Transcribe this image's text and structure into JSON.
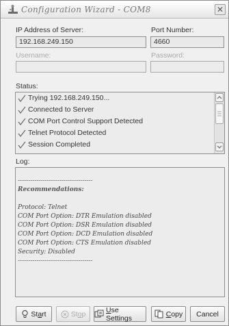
{
  "window": {
    "title": "Configuration Wizard - COM8"
  },
  "server": {
    "ip_label": "IP Address of Server:",
    "ip_value": "192.168.249.150",
    "port_label": "Port Number:",
    "port_value": "4660"
  },
  "auth": {
    "username_label": "Username:",
    "username_value": "",
    "password_label": "Password:",
    "password_value": ""
  },
  "status": {
    "label": "Status:",
    "lines": [
      "Trying 192.168.249.150...",
      "Connected to Server",
      "COM Port Control Support Detected",
      "Telnet Protocol Detected",
      "Session Completed"
    ]
  },
  "log": {
    "label": "Log:",
    "lines": [
      "------------------------------------",
      "Recommendations:",
      "",
      "Protocol: Telnet",
      "COM Port Option: DTR Emulation disabled",
      "COM Port Option: DSR Emulation disabled",
      "COM Port Option: DCD Emulation disabled",
      "COM Port Option: CTS Emulation disabled",
      "Security: Disabled",
      "------------------------------------"
    ]
  },
  "buttons": {
    "start": {
      "label": "Start",
      "underline": "a"
    },
    "stop": {
      "label": "Stop",
      "underline": "o"
    },
    "use_settings": {
      "label": "Use Settings",
      "underline": "U"
    },
    "copy": {
      "label": "Copy",
      "underline": "C"
    },
    "cancel": {
      "label": "Cancel"
    }
  }
}
